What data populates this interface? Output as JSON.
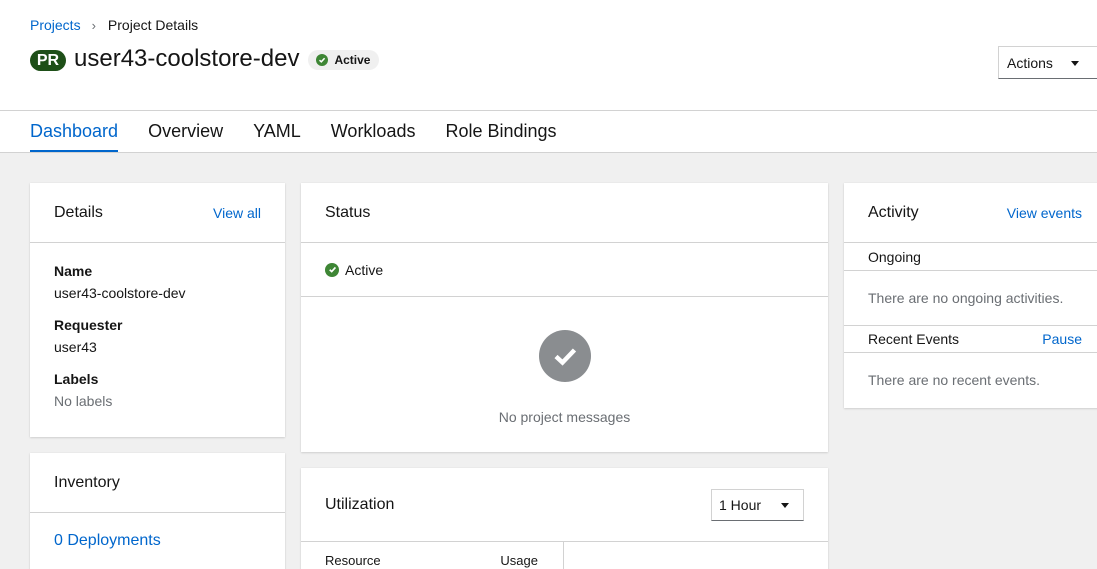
{
  "breadcrumb": {
    "parent": "Projects",
    "separator": "›",
    "current": "Project Details"
  },
  "header": {
    "badge": "PR",
    "title": "user43-coolstore-dev",
    "status": "Active",
    "actions_label": "Actions"
  },
  "tabs": [
    {
      "label": "Dashboard",
      "active": true
    },
    {
      "label": "Overview",
      "active": false
    },
    {
      "label": "YAML",
      "active": false
    },
    {
      "label": "Workloads",
      "active": false
    },
    {
      "label": "Role Bindings",
      "active": false
    }
  ],
  "details": {
    "title": "Details",
    "link": "View all",
    "fields": [
      {
        "label": "Name",
        "value": "user43-coolstore-dev"
      },
      {
        "label": "Requester",
        "value": "user43"
      },
      {
        "label": "Labels",
        "value": "No labels"
      }
    ]
  },
  "inventory": {
    "title": "Inventory",
    "link": "0 Deployments"
  },
  "status_card": {
    "title": "Status",
    "state": "Active",
    "empty_message": "No project messages"
  },
  "utilization": {
    "title": "Utilization",
    "range": "1 Hour",
    "col_resource": "Resource",
    "col_usage": "Usage"
  },
  "activity": {
    "title": "Activity",
    "link": "View events",
    "ongoing_label": "Ongoing",
    "ongoing_empty": "There are no ongoing activities.",
    "recent_label": "Recent Events",
    "pause_label": "Pause",
    "recent_empty": "There are no recent events."
  },
  "colors": {
    "link": "#0066cc",
    "success": "#3e8635",
    "badge": "#1e4f18"
  }
}
